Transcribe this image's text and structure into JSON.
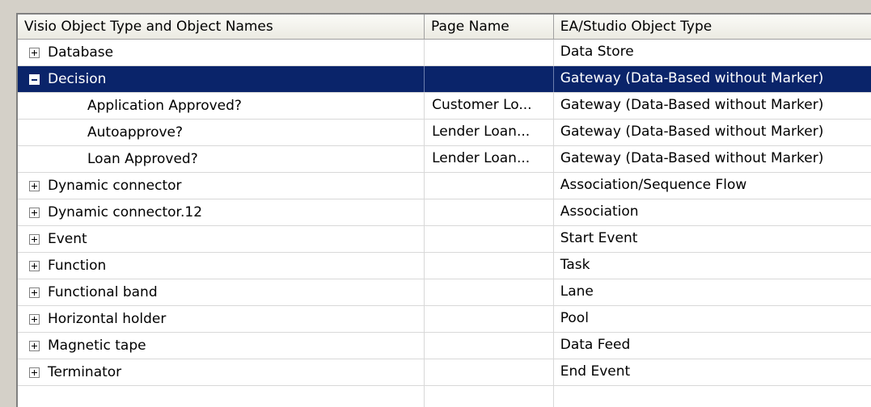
{
  "columns": {
    "name": "Visio Object Type and Object Names",
    "page": "Page Name",
    "type": "EA/Studio Object Type"
  },
  "rows": [
    {
      "name": "Database",
      "page": "",
      "type": "Data Store",
      "expander": "plus"
    },
    {
      "name": "Decision",
      "page": "",
      "type": "Gateway (Data-Based without Marker)",
      "expander": "minus",
      "selected": true
    },
    {
      "name": "Application Approved?",
      "page": "Customer Lo...",
      "type": "Gateway (Data-Based without Marker)",
      "child": true
    },
    {
      "name": "Autoapprove?",
      "page": "Lender Loan...",
      "type": "Gateway (Data-Based without Marker)",
      "child": true
    },
    {
      "name": "Loan Approved?",
      "page": "Lender Loan...",
      "type": "Gateway (Data-Based without Marker)",
      "child": true
    },
    {
      "name": "Dynamic connector",
      "page": "",
      "type": "Association/Sequence Flow",
      "expander": "plus"
    },
    {
      "name": "Dynamic connector.12",
      "page": "",
      "type": "Association",
      "expander": "plus"
    },
    {
      "name": "Event",
      "page": "",
      "type": "Start Event",
      "expander": "plus"
    },
    {
      "name": "Function",
      "page": "",
      "type": "Task",
      "expander": "plus"
    },
    {
      "name": "Functional band",
      "page": "",
      "type": "Lane",
      "expander": "plus"
    },
    {
      "name": "Horizontal holder",
      "page": "",
      "type": "Pool",
      "expander": "plus"
    },
    {
      "name": "Magnetic tape",
      "page": "",
      "type": "Data Feed",
      "expander": "plus"
    },
    {
      "name": "Terminator",
      "page": "",
      "type": "End Event",
      "expander": "plus"
    }
  ],
  "colors": {
    "selection": "#0a246a",
    "window": "#d4d0c8"
  }
}
